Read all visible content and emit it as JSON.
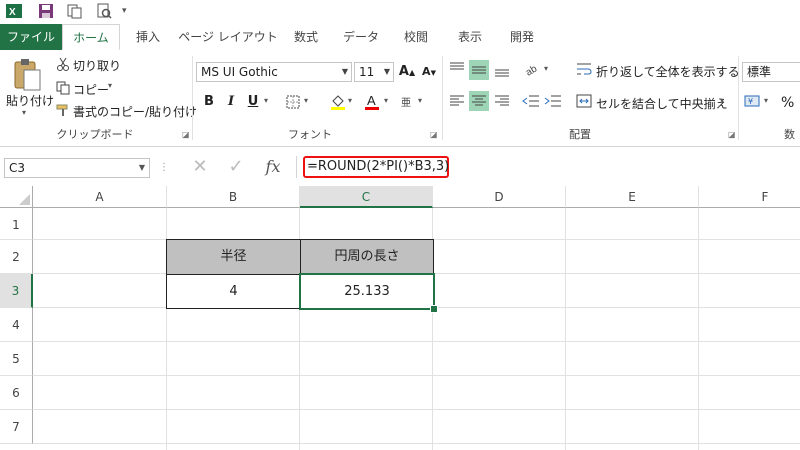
{
  "quick_access": {
    "icons": [
      "excel-logo-icon",
      "save-icon",
      "undo-icon",
      "print-preview-icon",
      "customize-qat-icon"
    ]
  },
  "tabs": [
    "ファイル",
    "ホーム",
    "挿入",
    "ページ レイアウト",
    "数式",
    "データ",
    "校閲",
    "表示",
    "開発"
  ],
  "ribbon": {
    "clipboard": {
      "paste_label": "貼り付け",
      "cut_label": "切り取り",
      "copy_label": "コピー",
      "format_painter_label": "書式のコピー/貼り付け",
      "group_label": "クリップボード"
    },
    "font": {
      "font_name": "MS UI Gothic",
      "font_size": "11",
      "bold": "B",
      "italic": "I",
      "underline": "U",
      "group_label": "フォント"
    },
    "alignment": {
      "wrap_text_label": "折り返して全体を表示する",
      "merge_center_label": "セルを結合して中央揃え",
      "group_label": "配置"
    },
    "number": {
      "format": "標準",
      "percent": "%",
      "group_label": "数"
    }
  },
  "formula_bar": {
    "name_box": "C3",
    "cancel_symbol": "✕",
    "enter_symbol": "✓",
    "fx_label": "fx",
    "formula": "=ROUND(2*PI()*B3,3)"
  },
  "sheet": {
    "columns": [
      "A",
      "B",
      "C",
      "D",
      "E",
      "F"
    ],
    "rows": [
      "1",
      "2",
      "3",
      "4",
      "5",
      "6",
      "7"
    ],
    "cells": {
      "B2": "半径",
      "C2": "円周の長さ",
      "B3": "4",
      "C3": "25.133"
    },
    "selected_cell": "C3"
  },
  "colors": {
    "accent": "#217346",
    "header_fill": "#c0c0c0",
    "highlight_border": "#e11111"
  }
}
